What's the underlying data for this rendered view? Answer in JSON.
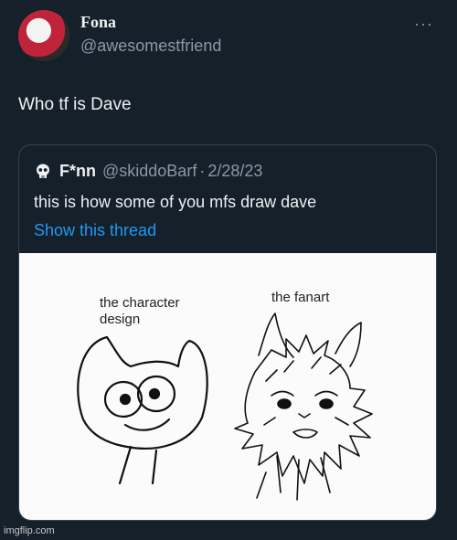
{
  "tweet": {
    "author_name": "Fona",
    "author_handle": "@awesomestfriend",
    "more_label": "···",
    "text": "Who tf is Dave"
  },
  "quoted_tweet": {
    "author_name": "F*nn",
    "author_handle": "@skiddoBarf",
    "separator": "·",
    "date": "2/28/23",
    "text": "this is how some of you mfs draw dave",
    "thread_link": "Show this thread",
    "media": {
      "caption_left": "the character design",
      "caption_right": "the fanart"
    }
  },
  "watermark": "imgflip.com",
  "colors": {
    "background": "#15202b",
    "link": "#1d9bf0",
    "secondary_text": "#8899a6",
    "border": "#38444d"
  }
}
